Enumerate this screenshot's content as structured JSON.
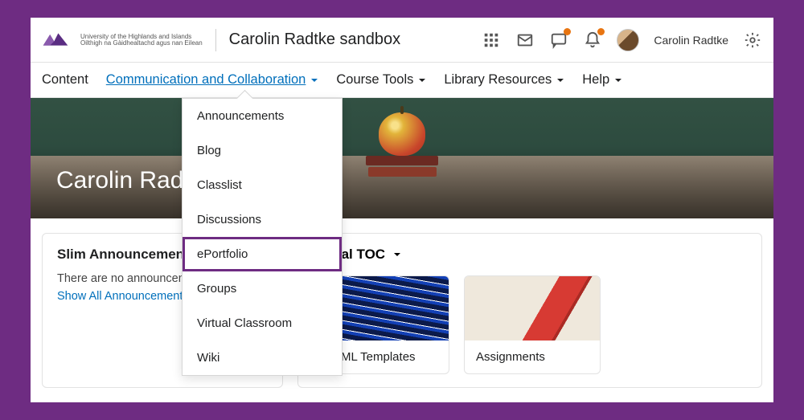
{
  "header": {
    "logo_text": "University of the Highlands and Islands",
    "logo_text2": "Oilthigh na Gàidhealtachd agus nan Eilean",
    "course_title": "Carolin Radtke sandbox",
    "username": "Carolin Radtke"
  },
  "nav": {
    "items": [
      {
        "label": "Content",
        "has_chev": false,
        "active": false
      },
      {
        "label": "Communication and Collaboration",
        "has_chev": true,
        "active": true
      },
      {
        "label": "Course Tools",
        "has_chev": true,
        "active": false
      },
      {
        "label": "Library Resources",
        "has_chev": true,
        "active": false
      },
      {
        "label": "Help",
        "has_chev": true,
        "active": false
      }
    ]
  },
  "dropdown": {
    "items": [
      "Announcements",
      "Blog",
      "Classlist",
      "Discussions",
      "ePortfolio",
      "Groups",
      "Virtual Classroom",
      "Wiki"
    ],
    "highlighted_index": 4
  },
  "banner": {
    "title": "Carolin Radtke sandbox"
  },
  "announcements": {
    "title": "Slim Announcements",
    "empty": "There are no announcements",
    "show_all": "Show All Announcements"
  },
  "visual_toc": {
    "title": "Visual TOC",
    "cards": [
      {
        "label": "HTML Templates"
      },
      {
        "label": "Assignments"
      }
    ]
  }
}
